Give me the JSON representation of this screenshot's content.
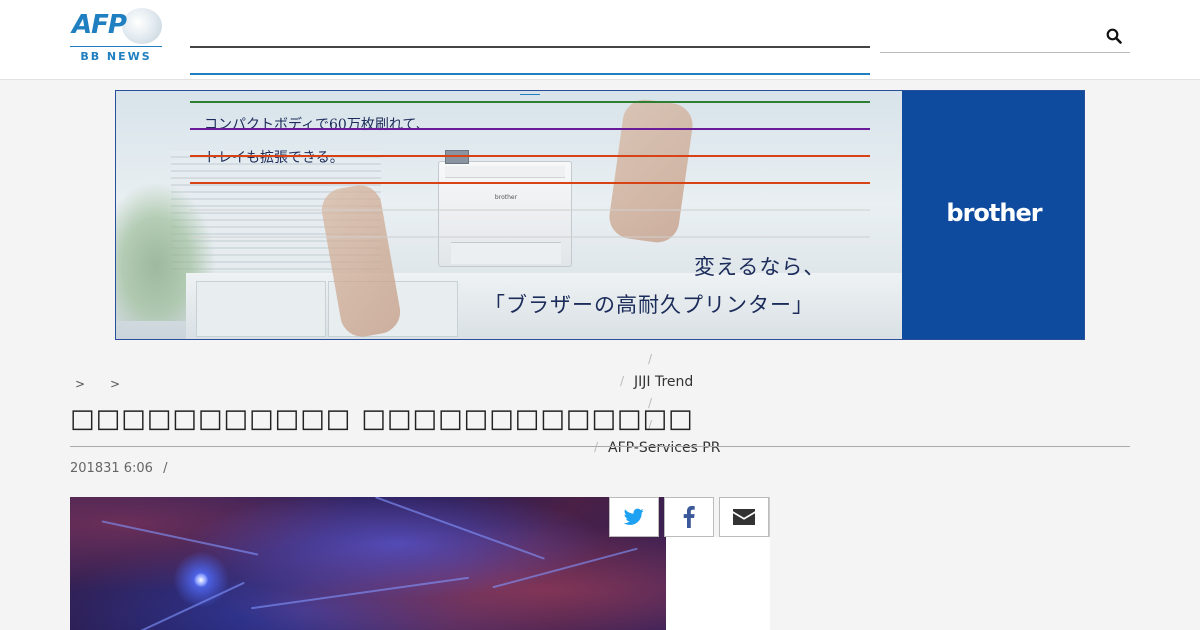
{
  "header": {
    "logo": {
      "brand": "AFP",
      "subtitle": "BB NEWS"
    },
    "search": {
      "placeholder": "",
      "icon": "search-icon"
    }
  },
  "ad": {
    "copy_line_1": "コンパクトボディで60万枚刷れて、",
    "copy_line_2": "トレイも拡張できる。",
    "headline_1": "変えるなら、",
    "headline_2": "「ブラザーの高耐久プリンター」",
    "brand": "brother",
    "printer_label": "brother",
    "colors": {
      "brand_panel": "#0e4a9e",
      "text": "#1c2c5a"
    }
  },
  "overlay_lines": [
    "#2e7d32",
    "#6a1b9a",
    "#d84315",
    "#d84315",
    "#cfcfcf",
    "#cfcfcf"
  ],
  "breadcrumb": {
    "sep_1": ">",
    "sep_2": ">"
  },
  "categories": {
    "link_1": "JIJI Trend",
    "link_2": "AFP-Services PR",
    "separator": "/"
  },
  "article": {
    "title": "□□□□□□□□□□□ □□□□□□□□□□□□□",
    "date": "201831 6:06",
    "date_separator": "/"
  },
  "share": {
    "twitter": "twitter-icon",
    "facebook": "facebook-icon",
    "email": "email-icon",
    "colors": {
      "twitter": "#1da1f2",
      "facebook": "#3b5998",
      "email": "#333333"
    }
  },
  "colors": {
    "accent": "#1f7fc1",
    "background": "#f4f4f4"
  }
}
